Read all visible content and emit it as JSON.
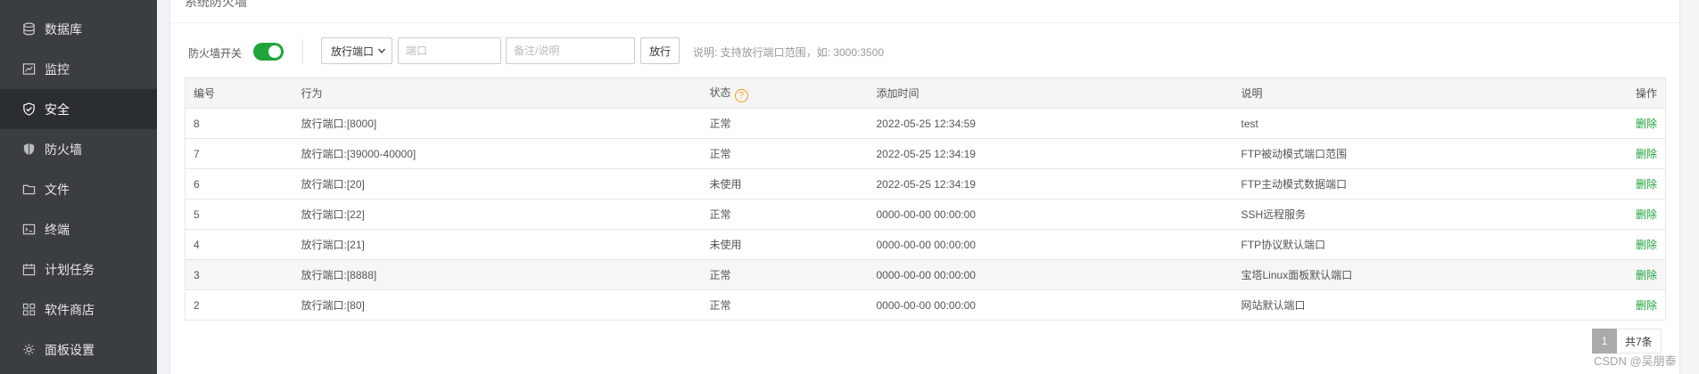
{
  "sidebar": {
    "items": [
      {
        "label": "数据库",
        "icon": "database-icon",
        "active": false
      },
      {
        "label": "监控",
        "icon": "monitor-icon",
        "active": false
      },
      {
        "label": "安全",
        "icon": "shield-check-icon",
        "active": true
      },
      {
        "label": "防火墙",
        "icon": "firewall-shield-icon",
        "active": false
      },
      {
        "label": "文件",
        "icon": "folder-icon",
        "active": false
      },
      {
        "label": "终端",
        "icon": "terminal-icon",
        "active": false
      },
      {
        "label": "计划任务",
        "icon": "calendar-icon",
        "active": false
      },
      {
        "label": "软件商店",
        "icon": "apps-grid-icon",
        "active": false
      },
      {
        "label": "面板设置",
        "icon": "gear-icon",
        "active": false
      }
    ]
  },
  "panel": {
    "title": "系统防火墙"
  },
  "toolbar": {
    "toggle_label": "防火墙开关",
    "toggle_on": true,
    "select_value": "放行端口",
    "port_placeholder": "端口",
    "note_placeholder": "备注/说明",
    "submit_label": "放行",
    "hint": "说明: 支持放行端口范围，如: 3000:3500"
  },
  "table": {
    "headers": [
      "编号",
      "行为",
      "状态",
      "添加时间",
      "说明",
      "操作"
    ],
    "rows": [
      {
        "id": "8",
        "action": "放行端口:[8000]",
        "status": "正常",
        "time": "2022-05-25 12:34:59",
        "note": "test",
        "op": "删除"
      },
      {
        "id": "7",
        "action": "放行端口:[39000-40000]",
        "status": "正常",
        "time": "2022-05-25 12:34:19",
        "note": "FTP被动模式端口范围",
        "op": "删除"
      },
      {
        "id": "6",
        "action": "放行端口:[20]",
        "status": "未使用",
        "time": "2022-05-25 12:34:19",
        "note": "FTP主动模式数据端口",
        "op": "删除"
      },
      {
        "id": "5",
        "action": "放行端口:[22]",
        "status": "正常",
        "time": "0000-00-00 00:00:00",
        "note": "SSH远程服务",
        "op": "删除"
      },
      {
        "id": "4",
        "action": "放行端口:[21]",
        "status": "未使用",
        "time": "0000-00-00 00:00:00",
        "note": "FTP协议默认端口",
        "op": "删除"
      },
      {
        "id": "3",
        "action": "放行端口:[8888]",
        "status": "正常",
        "time": "0000-00-00 00:00:00",
        "note": "宝塔Linux面板默认端口",
        "op": "删除"
      },
      {
        "id": "2",
        "action": "放行端口:[80]",
        "status": "正常",
        "time": "0000-00-00 00:00:00",
        "note": "网站默认端口",
        "op": "删除"
      }
    ]
  },
  "pagination": {
    "current": "1",
    "total_label": "共7条"
  },
  "watermark": "CSDN @吴朋泰",
  "colors": {
    "accent": "#20a53a",
    "sidebar_bg": "#3a3d41",
    "sidebar_active": "#2a2d31",
    "help": "#f39c12"
  }
}
